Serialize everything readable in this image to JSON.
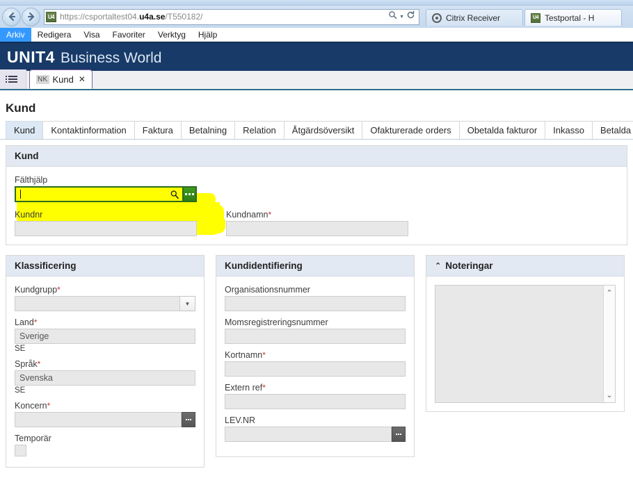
{
  "browser": {
    "back_label": "Back",
    "forward_label": "Forward",
    "url_prefix": "https://csportaltest04.",
    "url_domain": "u4a.se",
    "url_suffix": "/T550182/",
    "favicon_label": "U4",
    "search_icon": "search-icon",
    "refresh_icon": "refresh-icon",
    "tabs": [
      {
        "label": "Citrix Receiver",
        "icon": "citrix-icon",
        "active": false
      },
      {
        "label": "Testportal - H",
        "icon": "u4-icon",
        "active": true
      }
    ],
    "menu": [
      {
        "label": "Arkiv",
        "selected": true
      },
      {
        "label": "Redigera",
        "selected": false
      },
      {
        "label": "Visa",
        "selected": false
      },
      {
        "label": "Favoriter",
        "selected": false
      },
      {
        "label": "Verktyg",
        "selected": false
      },
      {
        "label": "Hjälp",
        "selected": false
      }
    ]
  },
  "app": {
    "brand_mark": "UNIT4",
    "brand_sub": "Business World",
    "grid_icon": "app-menu-grid-icon",
    "tab": {
      "badge": "NK",
      "label": "Kund",
      "close_label": "✕"
    }
  },
  "page": {
    "title": "Kund",
    "form_tabs": [
      {
        "label": "Kund",
        "active": true
      },
      {
        "label": "Kontaktinformation",
        "active": false
      },
      {
        "label": "Faktura",
        "active": false
      },
      {
        "label": "Betalning",
        "active": false
      },
      {
        "label": "Relation",
        "active": false
      },
      {
        "label": "Åtgärdsöversikt",
        "active": false
      },
      {
        "label": "Ofakturerade orders",
        "active": false
      },
      {
        "label": "Obetalda fakturor",
        "active": false
      },
      {
        "label": "Inkasso",
        "active": false
      },
      {
        "label": "Betalda",
        "active": false
      }
    ]
  },
  "kund_panel": {
    "title": "Kund",
    "field_help": {
      "label": "Fälthjälp",
      "value": "",
      "search_icon": "magnifier-icon",
      "browse_icon": "browse-ellipsis-icon"
    },
    "kundnr": {
      "label": "Kundnr",
      "value": "",
      "required": false
    },
    "kundnamn": {
      "label": "Kundnamn",
      "value": "",
      "required": true
    }
  },
  "klassificering": {
    "title": "Klassificering",
    "kundgrupp": {
      "label": "Kundgrupp",
      "value": "",
      "required": true
    },
    "land": {
      "label": "Land",
      "value": "Sverige",
      "sub": "SE",
      "required": true
    },
    "sprak": {
      "label": "Språk",
      "value": "Svenska",
      "sub": "SE",
      "required": true
    },
    "koncern": {
      "label": "Koncern",
      "value": "",
      "required": true
    },
    "temporar": {
      "label": "Temporär",
      "checked": false
    }
  },
  "kundidentifiering": {
    "title": "Kundidentifiering",
    "organisationsnummer": {
      "label": "Organisationsnummer",
      "value": "",
      "required": false
    },
    "momsregistreringsnummer": {
      "label": "Momsregistreringsnummer",
      "value": "",
      "required": false
    },
    "kortnamn": {
      "label": "Kortnamn",
      "value": "",
      "required": true
    },
    "extern_ref": {
      "label": "Extern ref",
      "value": "",
      "required": true
    },
    "lev_nr": {
      "label": "LEV.NR",
      "value": "",
      "required": false
    }
  },
  "noteringar": {
    "title": "Noteringar",
    "collapse_icon": "chevron-up-icon",
    "value": "",
    "scroll_up": "⌃",
    "scroll_down": "⌄"
  },
  "colors": {
    "brand_blue": "#173a68",
    "highlight_yellow": "#ffff00",
    "green_button": "#2f7d16",
    "required_red": "#cc3333",
    "panel_head": "#e3e9f2",
    "active_tab": "#dce9f5"
  }
}
